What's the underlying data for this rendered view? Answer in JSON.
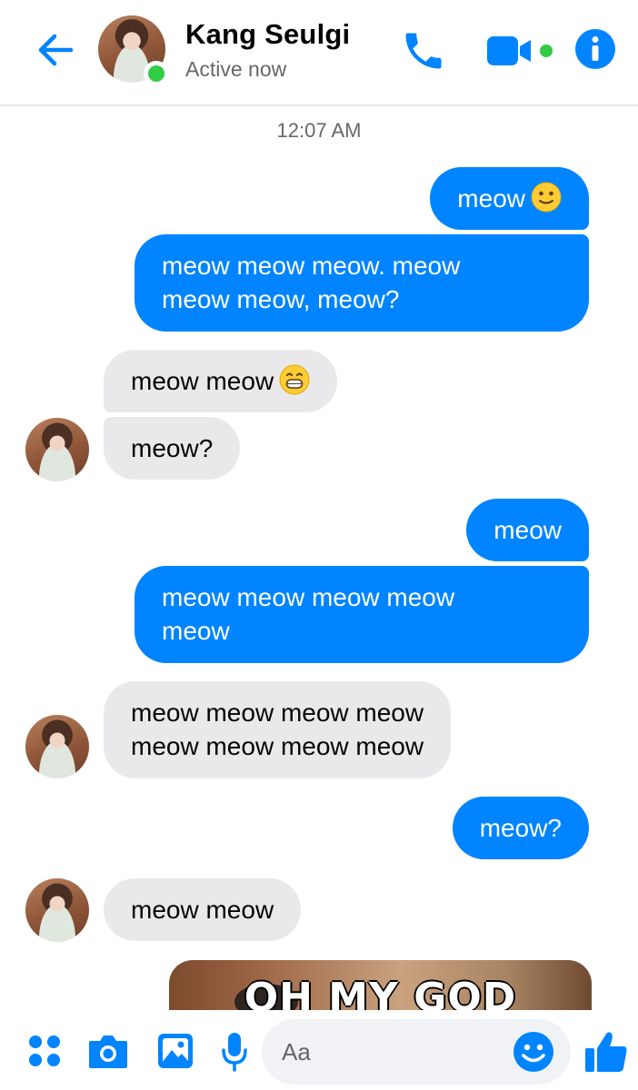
{
  "header": {
    "contact_name": "Kang Seulgi",
    "status": "Active now",
    "accent_color": "#0084ff",
    "online_color": "#31cc46"
  },
  "chat": {
    "timestamp": "12:07 AM",
    "messages": [
      {
        "from": "me",
        "text": "meow",
        "emoji": "slightly-smiling-face"
      },
      {
        "from": "me",
        "lines": [
          "meow meow meow. meow",
          "meow meow, meow?"
        ]
      },
      {
        "from": "them",
        "text": "meow meow",
        "emoji": "grinning-face"
      },
      {
        "from": "them",
        "text": "meow?"
      },
      {
        "from": "me",
        "text": "meow"
      },
      {
        "from": "me",
        "lines": [
          "meow meow meow meow",
          "meow"
        ]
      },
      {
        "from": "them",
        "lines": [
          "meow meow meow meow",
          "meow meow meow meow"
        ]
      },
      {
        "from": "me",
        "text": "meow?"
      },
      {
        "from": "them",
        "text": "meow meow"
      }
    ],
    "image_caption": "OH MY GOD"
  },
  "composer": {
    "placeholder": "Aa",
    "icons": [
      "grid-icon",
      "camera-icon",
      "photo-icon",
      "microphone-icon",
      "emoji-icon",
      "thumbs-up-icon"
    ]
  }
}
